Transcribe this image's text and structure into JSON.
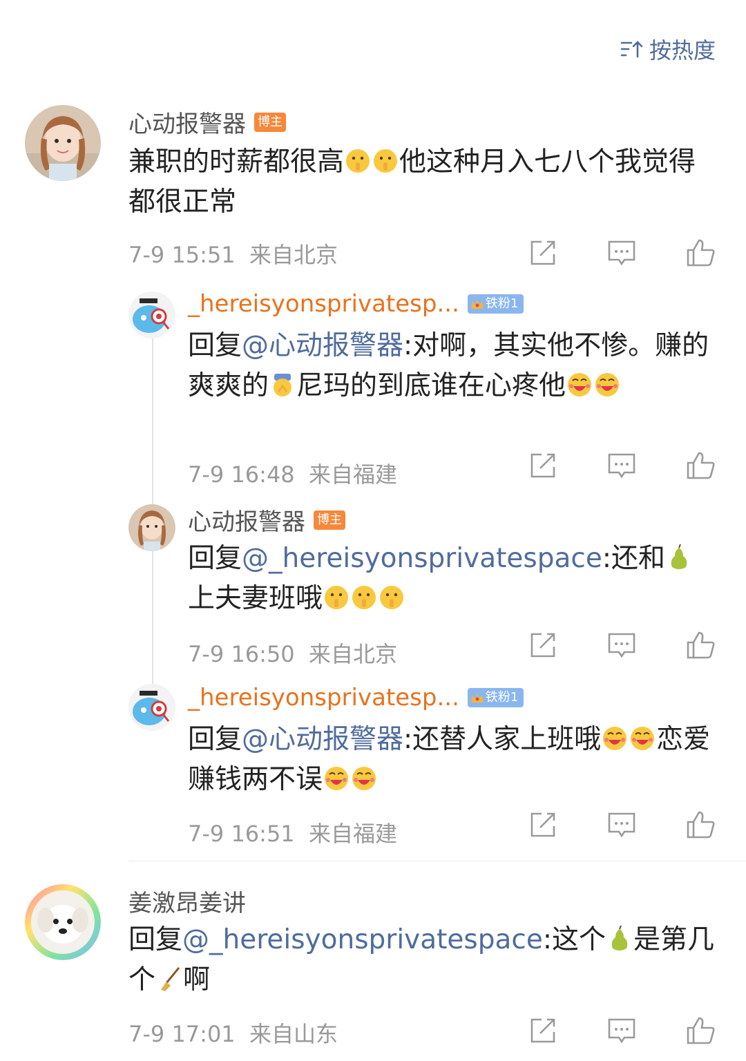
{
  "sort": {
    "label": "按热度",
    "icon": "sort-icon"
  },
  "comments": [
    {
      "name": "心动报警器",
      "badge": "博主",
      "text_parts": [
        "兼职的时薪都很高",
        "他这种月入七八个我觉得都很正常"
      ],
      "time": "7-9 15:51",
      "location": "来自北京"
    },
    {
      "name": "_hereisyonsprivatesp...",
      "badge": "铁粉1",
      "reply_prefix": "回复",
      "mention": "@心动报警器",
      "text_a": ":对啊，其实他不惨。赚的爽爽的",
      "text_b": "尼玛的到底谁在心疼他",
      "time": "7-9 16:48",
      "location": "来自福建"
    },
    {
      "name": "心动报警器",
      "badge": "博主",
      "reply_prefix": "回复",
      "mention": "@_hereisyonsprivatespace",
      "text_a": ":还和",
      "text_b": "上夫妻班哦",
      "time": "7-9 16:50",
      "location": "来自北京"
    },
    {
      "name": "_hereisyonsprivatesp...",
      "badge": "铁粉1",
      "reply_prefix": "回复",
      "mention": "@心动报警器",
      "text_a": ":还替人家上班哦",
      "text_b": "恋爱赚钱两不误",
      "time": "7-9 16:51",
      "location": "来自福建"
    },
    {
      "name": "姜激昂姜讲",
      "reply_prefix": "回复",
      "mention": "@_hereisyonsprivatespace",
      "text_a": ":这个",
      "text_b": "是第几个",
      "text_c": "啊",
      "time": "7-9 17:01",
      "location": "来自山东"
    }
  ],
  "colors": {
    "link": "#4f6c9d",
    "orange_name": "#e8721c",
    "meta": "#999999"
  }
}
